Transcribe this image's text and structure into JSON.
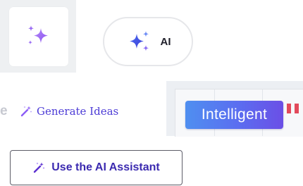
{
  "sparkle_tile": {
    "icon": "sparkle-icon"
  },
  "ai_pill": {
    "icon": "sparkle-icon",
    "label": "AI"
  },
  "fragment": {
    "text": "e"
  },
  "generate_link": {
    "icon": "magic-wand-icon",
    "label": "Generate Ideas"
  },
  "intelligent_panel": {
    "badge_label": "Intelligent"
  },
  "assistant_button": {
    "icon": "magic-wand-icon",
    "label": "Use the AI Assistant"
  },
  "colors": {
    "accent": "#4c3bd6",
    "sparkle": "#8b5cf6",
    "badge_gradient_start": "#4f8ff0",
    "badge_gradient_end": "#6b4fe6",
    "red_mark": "#e24a5b"
  }
}
